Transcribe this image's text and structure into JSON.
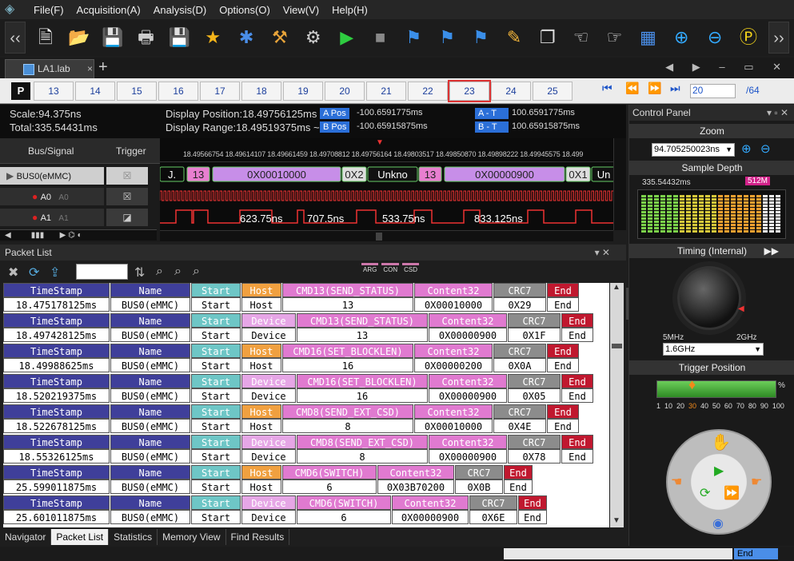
{
  "menu": [
    "File(F)",
    "Acquisition(A)",
    "Analysis(D)",
    "Options(O)",
    "View(V)",
    "Help(H)"
  ],
  "toolbar": {
    "prev": "‹‹",
    "next": "››",
    "icons": [
      "new-file-icon",
      "open-folder-icon",
      "save-icon",
      "print-icon",
      "save-settings-icon",
      "favorite-star-icon",
      "protocol-analyzer-icon",
      "tools-icon",
      "settings-gear-icon",
      "run-play-icon",
      "stop-icon",
      "add-marker-icon",
      "marker-icon",
      "marker-down-icon",
      "pen-light-icon",
      "copy-pages-icon",
      "hand-copy-icon",
      "hand-paste-icon",
      "binary-data-icon",
      "zoom-in-icon",
      "zoom-out-icon",
      "zoom-fit-icon"
    ]
  },
  "tab": {
    "label": "LA1.lab",
    "close": "×",
    "add": "+",
    "window_controls": "◀ ▶ – ▭ ✕"
  },
  "pages": {
    "p_label": "P",
    "numbers": [
      "13",
      "14",
      "15",
      "16",
      "17",
      "18",
      "19",
      "20",
      "21",
      "22",
      "23",
      "24",
      "25"
    ],
    "selected": "23",
    "current_input": "20",
    "total": "/64",
    "nav": [
      "⏮",
      "⏪",
      "⏩",
      "⏭"
    ]
  },
  "wave_info": {
    "scale": "Scale:94.375ns",
    "total": "Total:335.54431ms",
    "display_position": "Display Position:18.49756125ms",
    "display_range": "Display Range:18.49519375ms ~",
    "a_pos_label": "A Pos",
    "a_pos_value": "-100.6591775ms",
    "b_pos_label": "B Pos",
    "b_pos_value": "-100.65915875ms",
    "a_t_label": "A - T",
    "a_t_value": "100.6591775ms",
    "b_t_label": "B - T",
    "b_t_value": "100.65915875ms",
    "ruler": "18.49566754 18.49614107 18.49661459 18.49708812 18.49756164 18.49803517 18.49850870 18.49898222 18.49945575 18.499"
  },
  "signals": {
    "header_bus": "Bus/Signal",
    "header_trigger": "Trigger",
    "rows": [
      {
        "name": "BUS0(eMMC)",
        "sub": ""
      },
      {
        "name": "A0",
        "sub": "A0"
      },
      {
        "name": "A1",
        "sub": "A1"
      }
    ]
  },
  "waveform": {
    "bus_segments": [
      "J.",
      "13",
      "0X00010000",
      "0X2",
      "Unkno",
      "13",
      "0X00000900",
      "0X1",
      "Un"
    ],
    "timings": [
      "623.75ns",
      "707.5ns",
      "533.75ns",
      "833.125ns"
    ]
  },
  "packet_list": {
    "title": "Packet List",
    "filter_tags": [
      "ARG",
      "CON",
      "CSD"
    ],
    "colors": {
      "timestamp": "#3f3f9a",
      "start": "#6ec6c6",
      "host": "#f0a040",
      "device": "#e6a6e6",
      "cmd": "#e07ad0",
      "content": "#e07ad0",
      "crc": "#8c8c8c",
      "end": "#c0182f"
    },
    "headers": {
      "timestamp": "TimeStamp",
      "name": "Name",
      "start": "Start",
      "content": "Content32",
      "crc": "CRC7",
      "end": "End"
    },
    "packets": [
      {
        "timestamp": "18.475178125ms",
        "name": "BUS0(eMMC)",
        "start": "Start",
        "dir": "Host",
        "cmd": "CMD13(SEND_STATUS)",
        "cmd_val": "13",
        "content": "0X00010000",
        "crc": "0X29",
        "end": "End"
      },
      {
        "timestamp": "18.497428125ms",
        "name": "BUS0(eMMC)",
        "start": "Start",
        "dir": "Device",
        "cmd": "CMD13(SEND_STATUS)",
        "cmd_val": "13",
        "content": "0X00000900",
        "crc": "0X1F",
        "end": "End"
      },
      {
        "timestamp": "18.49988625ms",
        "name": "BUS0(eMMC)",
        "start": "Start",
        "dir": "Host",
        "cmd": "CMD16(SET_BLOCKLEN)",
        "cmd_val": "16",
        "content": "0X00000200",
        "crc": "0X0A",
        "end": "End"
      },
      {
        "timestamp": "18.520219375ms",
        "name": "BUS0(eMMC)",
        "start": "Start",
        "dir": "Device",
        "cmd": "CMD16(SET_BLOCKLEN)",
        "cmd_val": "16",
        "content": "0X00000900",
        "crc": "0X05",
        "end": "End"
      },
      {
        "timestamp": "18.522678125ms",
        "name": "BUS0(eMMC)",
        "start": "Start",
        "dir": "Host",
        "cmd": "CMD8(SEND_EXT_CSD)",
        "cmd_val": "8",
        "content": "0X00010000",
        "crc": "0X4E",
        "end": "End"
      },
      {
        "timestamp": "18.55326125ms",
        "name": "BUS0(eMMC)",
        "start": "Start",
        "dir": "Device",
        "cmd": "CMD8(SEND_EXT_CSD)",
        "cmd_val": "8",
        "content": "0X00000900",
        "crc": "0X78",
        "end": "End"
      },
      {
        "timestamp": "25.599011875ms",
        "name": "BUS0(eMMC)",
        "start": "Start",
        "dir": "Host",
        "cmd": "CMD6(SWITCH)",
        "cmd_val": "6",
        "content": "0X03B70200",
        "crc": "0X0B",
        "end": "End"
      },
      {
        "timestamp": "25.601011875ms",
        "name": "BUS0(eMMC)",
        "start": "Start",
        "dir": "Device",
        "cmd": "CMD6(SWITCH)",
        "cmd_val": "6",
        "content": "0X00000900",
        "crc": "0X6E",
        "end": "End"
      }
    ]
  },
  "bottom_tabs": [
    "Navigator",
    "Packet List",
    "Statistics",
    "Memory View",
    "Find Results"
  ],
  "active_bottom_tab": "Packet List",
  "control_panel": {
    "title": "Control Panel",
    "zoom_label": "Zoom",
    "zoom_value": "94.705250023ns",
    "sample_depth_label": "Sample Depth",
    "sample_depth_value": "335.54432ms",
    "sample_depth_badge": "512M",
    "timing_label": "Timing (Internal)",
    "freq_min": "5MHz",
    "freq_max": "2GHz",
    "freq_value": "1.6GHz",
    "trigger_label": "Trigger Position",
    "trigger_scale": [
      "1",
      "10",
      "20",
      "30",
      "40",
      "50",
      "60",
      "70",
      "80",
      "90",
      "100"
    ],
    "trigger_value": "30",
    "trigger_unit": "%"
  },
  "status": {
    "end_label": "End"
  }
}
